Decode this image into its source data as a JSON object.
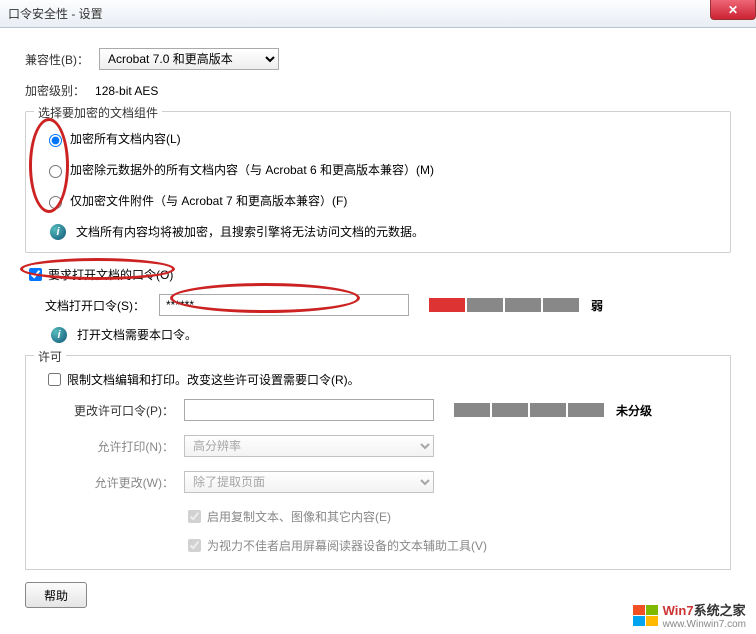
{
  "titlebar": {
    "title": "口令安全性 - 设置"
  },
  "compatibility": {
    "label": "兼容性(B)：",
    "selected": "Acrobat 7.0 和更高版本"
  },
  "encryption_level": {
    "label": "加密级别：",
    "value": "128-bit AES"
  },
  "encrypt_group": {
    "legend": "选择要加密的文档组件",
    "option1": "加密所有文档内容(L)",
    "option2": "加密除元数据外的所有文档内容（与 Acrobat 6 和更高版本兼容）(M)",
    "option3": "仅加密文件附件（与 Acrobat 7 和更高版本兼容）(F)",
    "info": "文档所有内容均将被加密，且搜索引擎将无法访问文档的元数据。"
  },
  "open_pw": {
    "require_label": "要求打开文档的口令(O)",
    "pw_label": "文档打开口令(S)：",
    "pw_value": "******",
    "strength_label": "弱",
    "info": "打开文档需要本口令。"
  },
  "permissions": {
    "legend": "许可",
    "restrict_label": "限制文档编辑和打印。改变这些许可设置需要口令(R)。",
    "change_pw_label": "更改许可口令(P)：",
    "strength_label": "未分级",
    "allow_print_label": "允许打印(N)：",
    "allow_print_value": "高分辨率",
    "allow_change_label": "允许更改(W)：",
    "allow_change_value": "除了提取页面",
    "enable_copy": "启用复制文本、图像和其它内容(E)",
    "enable_reader": "为视力不佳者启用屏幕阅读器设备的文本辅助工具(V)"
  },
  "footer": {
    "help": "帮助"
  },
  "watermark": {
    "brand1": "Win7",
    "brand2": "系统之家",
    "url": "www.Winwin7.com"
  }
}
